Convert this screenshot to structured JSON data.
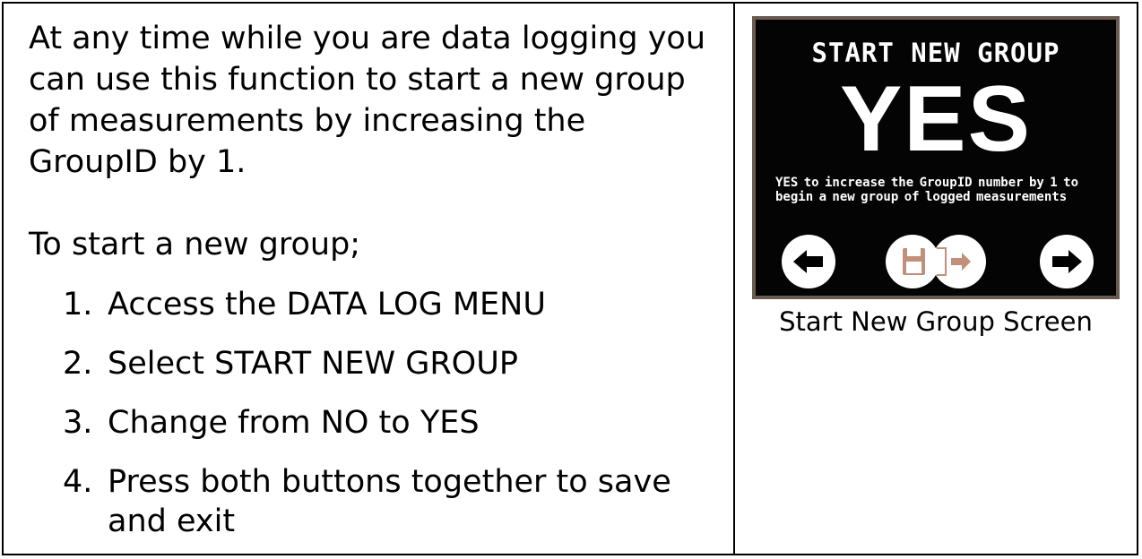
{
  "instructions": {
    "paragraph1": "At any time while you are data logging you can use this function to start a new group of measurements by increasing the GroupID by 1.",
    "paragraph2": "To start a new group;",
    "steps": [
      {
        "number": "1.",
        "text": "Access the DATA LOG MENU"
      },
      {
        "number": "2.",
        "text": "Select START NEW GROUP"
      },
      {
        "number": "3.",
        "text": "Change from NO to YES"
      },
      {
        "number": "4.",
        "text": "Press both buttons together to save and exit"
      }
    ]
  },
  "device_screen": {
    "title": "START NEW GROUP",
    "value": "YES",
    "description": "YES to increase the GroupID number by 1 to begin a new group of logged measurements",
    "icons": [
      "arrow-left-icon",
      "save-exit-icon",
      "arrow-right-icon"
    ],
    "colors": {
      "screen_background": "#040404",
      "text": "#ffffff",
      "frame": "#6a5a50",
      "save_icon": "#c0907a"
    }
  },
  "caption": "Start New Group Screen"
}
